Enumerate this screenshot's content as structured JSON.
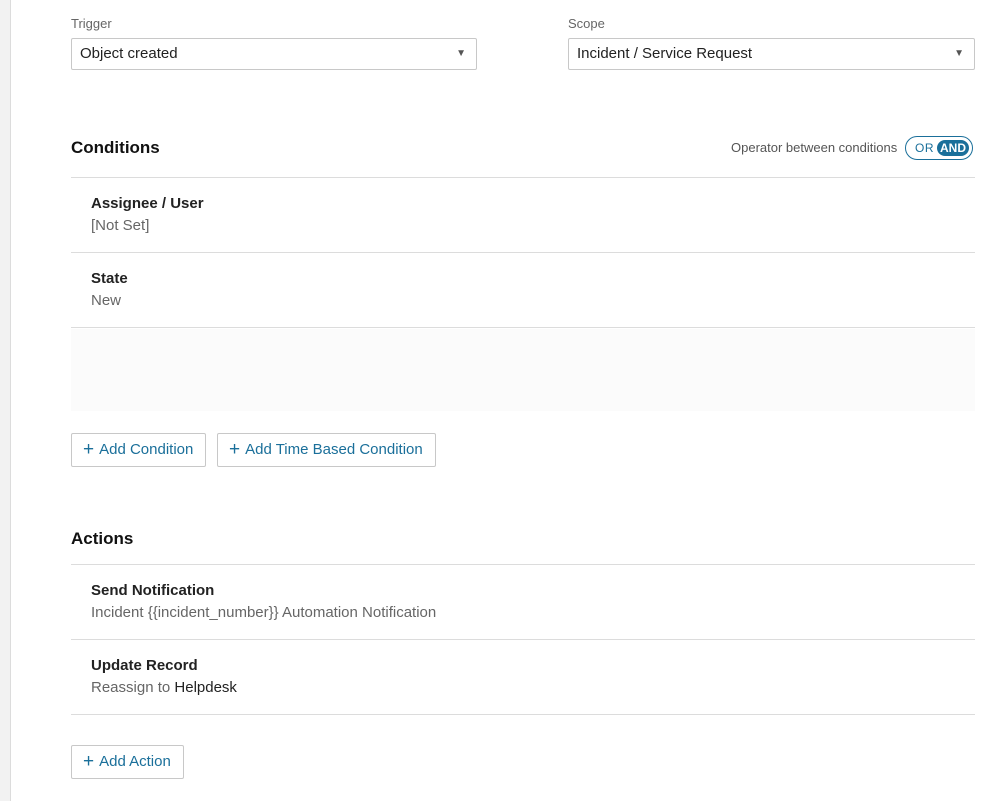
{
  "trigger": {
    "label": "Trigger",
    "value": "Object created"
  },
  "scope": {
    "label": "Scope",
    "value": "Incident / Service Request"
  },
  "conditions": {
    "title": "Conditions",
    "operator_label": "Operator between conditions",
    "operator_options": [
      "OR",
      "AND"
    ],
    "operator_selected": "AND",
    "items": [
      {
        "title": "Assignee / User",
        "value": "[Not Set]"
      },
      {
        "title": "State",
        "value": "New"
      }
    ],
    "add_condition": "Add Condition",
    "add_time_condition": "Add Time Based Condition"
  },
  "actions": {
    "title": "Actions",
    "items": [
      {
        "title": "Send Notification",
        "value": "Incident {{incident_number}} Automation Notification"
      },
      {
        "title": "Update Record",
        "value_prefix": "Reassign to",
        "value_target": "Helpdesk"
      }
    ],
    "add_action": "Add Action"
  },
  "icons": {
    "caret": "caret-down-icon",
    "plus": "plus-icon"
  },
  "colors": {
    "accent": "#1a6f9a",
    "border": "#dcdcdc",
    "muted_text": "#666666"
  }
}
